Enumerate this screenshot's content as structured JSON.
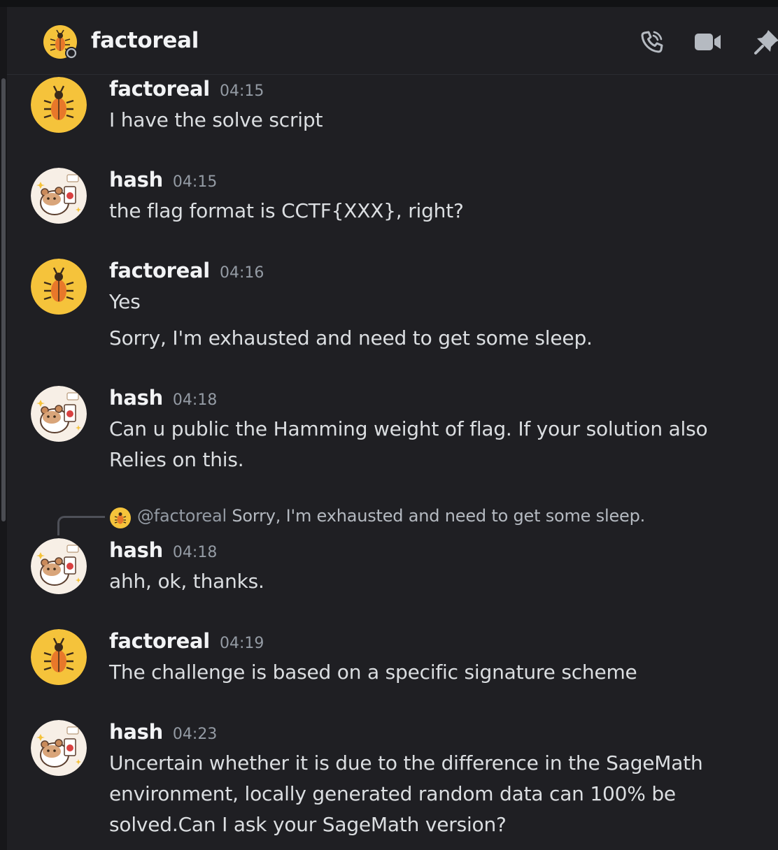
{
  "channel": {
    "title": "factoreal"
  },
  "colors": {
    "background": "#1f1f23",
    "avatar_yellow": "#f5c33b",
    "bug_orange": "#e8782a",
    "username": "#f2f3f5",
    "timestamp": "#949ba4"
  },
  "header_icons": [
    "phone-call-icon",
    "video-camera-icon",
    "pin-icon"
  ],
  "messages": [
    {
      "author": "factoreal",
      "time": "04:15",
      "lines": [
        "I have the solve script"
      ]
    },
    {
      "author": "hash",
      "time": "04:15",
      "lines": [
        "the flag format is CCTF{XXX}, right?"
      ]
    },
    {
      "author": "factoreal",
      "time": "04:16",
      "lines": [
        "Yes",
        "Sorry, I'm exhausted and need to get some sleep."
      ]
    },
    {
      "author": "hash",
      "time": "04:18",
      "lines": [
        "Can u public the Hamming weight of flag. If your solution also",
        "Relies on this."
      ]
    },
    {
      "author": "hash",
      "time": "04:18",
      "reply": {
        "mention": "@factoreal",
        "text": "Sorry, I'm exhausted and need to get some sleep."
      },
      "lines": [
        "ahh, ok, thanks."
      ]
    },
    {
      "author": "factoreal",
      "time": "04:19",
      "lines": [
        "The challenge is based on a specific signature scheme"
      ]
    },
    {
      "author": "hash",
      "time": "04:23",
      "lines": [
        "Uncertain whether it is due to the difference in the SageMath",
        "environment, locally generated random data can 100% be",
        "solved.Can I ask your SageMath version?"
      ]
    }
  ]
}
